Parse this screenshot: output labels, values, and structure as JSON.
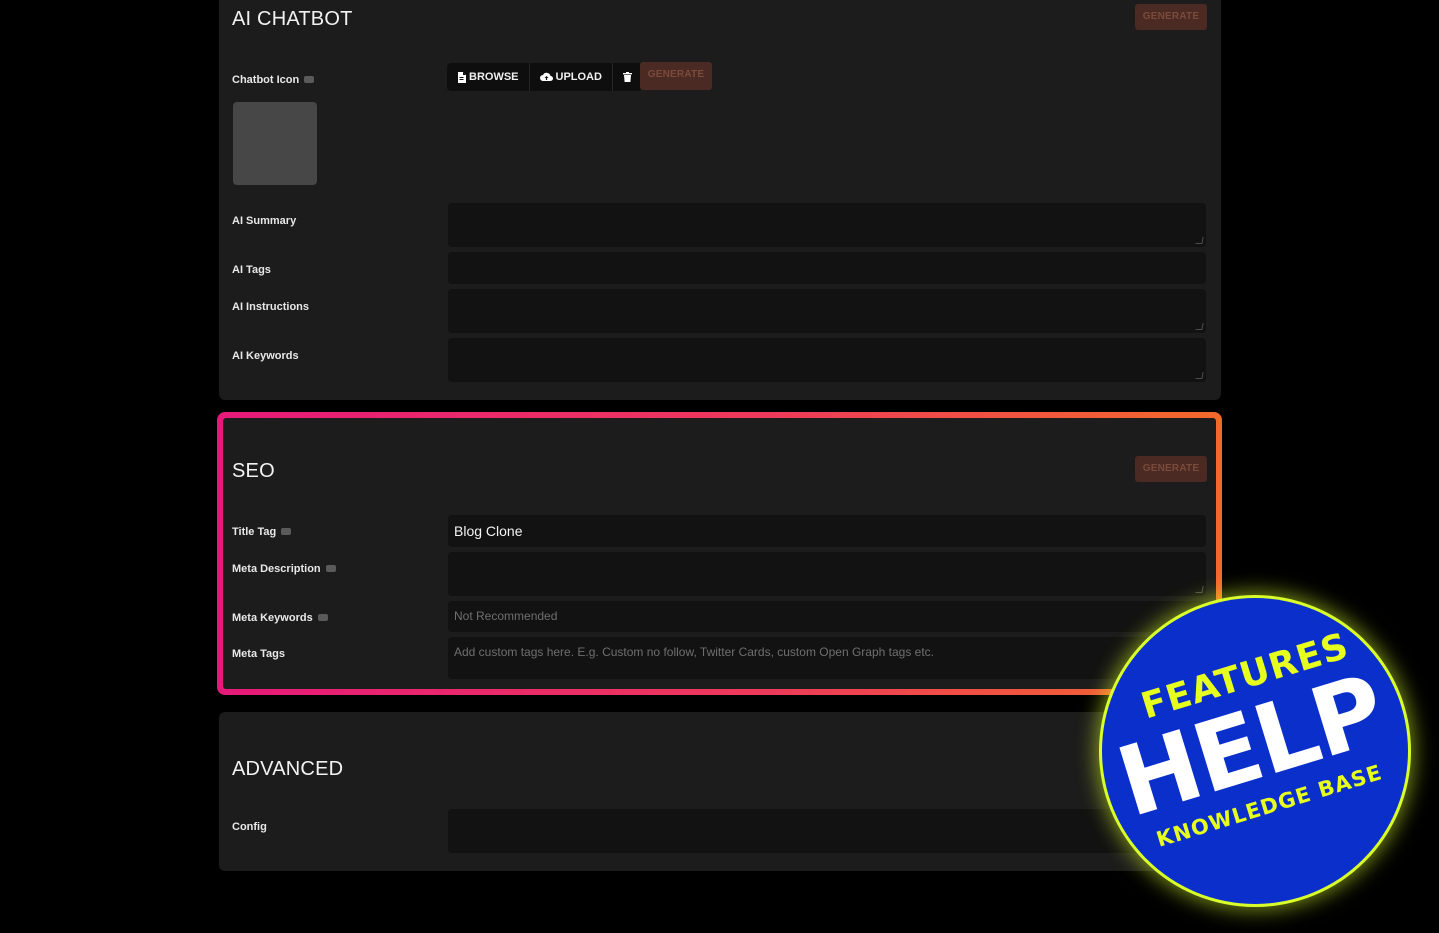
{
  "chatbot": {
    "title": "AI CHATBOT",
    "generate_label": "GENERATE",
    "icon_label": "Chatbot Icon",
    "browse_label": "BROWSE",
    "upload_label": "UPLOAD",
    "icon_generate_label": "GENERATE",
    "summary_label": "AI Summary",
    "tags_label": "AI Tags",
    "instructions_label": "AI Instructions",
    "keywords_label": "AI Keywords"
  },
  "seo": {
    "title": "SEO",
    "generate_label": "GENERATE",
    "title_tag_label": "Title Tag",
    "title_tag_value": "Blog Clone",
    "meta_description_label": "Meta Description",
    "meta_keywords_label": "Meta Keywords",
    "meta_keywords_placeholder": "Not Recommended",
    "meta_tags_label": "Meta Tags",
    "meta_tags_placeholder": "Add custom tags here. E.g. Custom no follow, Twitter Cards, custom Open Graph tags etc."
  },
  "advanced": {
    "title": "ADVANCED",
    "config_label": "Config"
  },
  "badge": {
    "line1": "FEATURES",
    "line2": "HELP",
    "line3": "KNOWLEDGE BASE"
  },
  "colors": {
    "background": "#000000",
    "panel": "#1c1c1c",
    "field": "#121212",
    "highlight_start": "#e6197a",
    "highlight_end": "#f26a2a",
    "badge_blue": "#0a2fcb",
    "badge_yellow": "#e6ff1f"
  }
}
